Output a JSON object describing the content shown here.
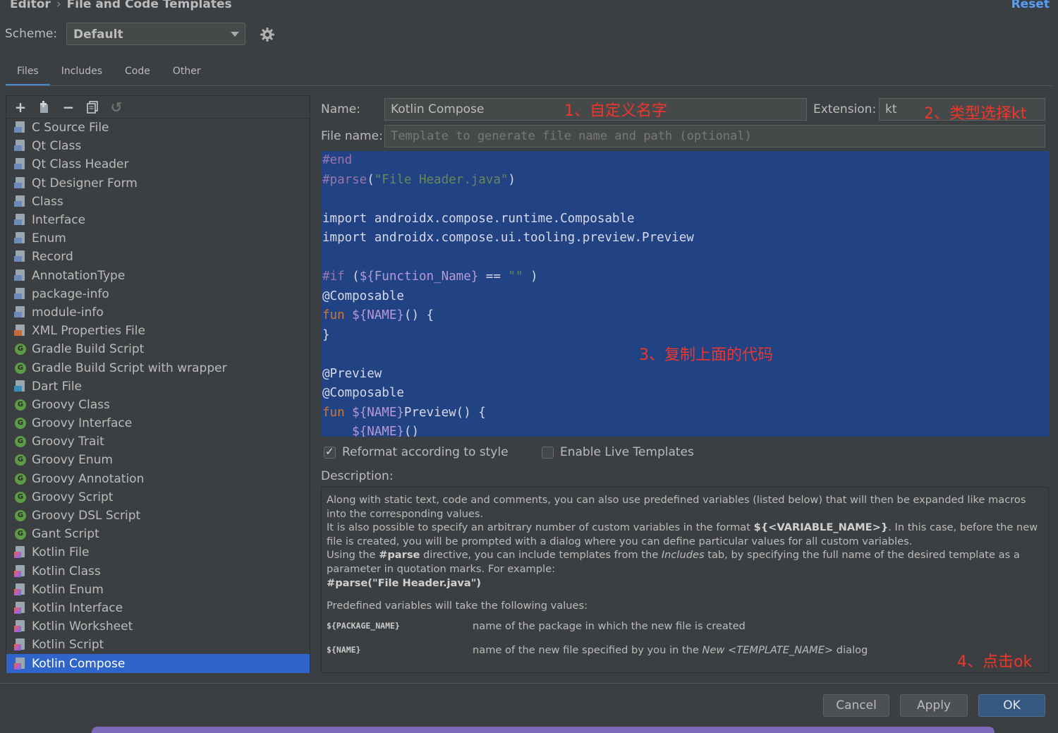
{
  "breadcrumb": {
    "parent": "Editor",
    "separator": "›",
    "current": "File and Code Templates"
  },
  "reset_label": "Reset",
  "scheme": {
    "label": "Scheme:",
    "value": "Default"
  },
  "tabs": [
    {
      "label": "Files",
      "active": true
    },
    {
      "label": "Includes"
    },
    {
      "label": "Code"
    },
    {
      "label": "Other"
    }
  ],
  "toolbar": {
    "add": "+",
    "remove": "−",
    "copy": "⧉",
    "reset": "↺"
  },
  "templates": [
    {
      "label": "C Source File",
      "icon": "doc"
    },
    {
      "label": "Qt Class",
      "icon": "doc"
    },
    {
      "label": "Qt Class Header",
      "icon": "doc"
    },
    {
      "label": "Qt Designer Form",
      "icon": "doc"
    },
    {
      "label": "Class",
      "icon": "doc"
    },
    {
      "label": "Interface",
      "icon": "doc"
    },
    {
      "label": "Enum",
      "icon": "doc"
    },
    {
      "label": "Record",
      "icon": "doc"
    },
    {
      "label": "AnnotationType",
      "icon": "doc"
    },
    {
      "label": "package-info",
      "icon": "doc"
    },
    {
      "label": "module-info",
      "icon": "doc"
    },
    {
      "label": "XML Properties File",
      "icon": "xml"
    },
    {
      "label": "Gradle Build Script",
      "icon": "gradle"
    },
    {
      "label": "Gradle Build Script with wrapper",
      "icon": "gradle"
    },
    {
      "label": "Dart File",
      "icon": "dart"
    },
    {
      "label": "Groovy Class",
      "icon": "gradle"
    },
    {
      "label": "Groovy Interface",
      "icon": "gradle"
    },
    {
      "label": "Groovy Trait",
      "icon": "gradle"
    },
    {
      "label": "Groovy Enum",
      "icon": "gradle"
    },
    {
      "label": "Groovy Annotation",
      "icon": "gradle"
    },
    {
      "label": "Groovy Script",
      "icon": "gradle"
    },
    {
      "label": "Groovy DSL Script",
      "icon": "gradle"
    },
    {
      "label": "Gant Script",
      "icon": "gradle"
    },
    {
      "label": "Kotlin File",
      "icon": "kotlin"
    },
    {
      "label": "Kotlin Class",
      "icon": "kotlin"
    },
    {
      "label": "Kotlin Enum",
      "icon": "kotlin"
    },
    {
      "label": "Kotlin Interface",
      "icon": "kotlin"
    },
    {
      "label": "Kotlin Worksheet",
      "icon": "kotlin"
    },
    {
      "label": "Kotlin Script",
      "icon": "kotlin"
    },
    {
      "label": "Kotlin Compose",
      "icon": "kotlin",
      "selected": true
    }
  ],
  "form": {
    "name_label": "Name:",
    "name_value": "Kotlin Compose",
    "extension_label": "Extension:",
    "extension_value": "kt",
    "filename_label": "File name:",
    "filename_placeholder": "Template to generate file name and path (optional)"
  },
  "annotations": {
    "a1": "1、自定义名字",
    "a2": "2、类型选择kt",
    "a3": "3、复制上面的代码",
    "a4": "4、点击ok"
  },
  "code_lines": [
    [
      {
        "t": "#end",
        "c": "dir"
      }
    ],
    [
      {
        "t": "#parse",
        "c": "dir"
      },
      {
        "t": "(",
        "c": "plain"
      },
      {
        "t": "\"File Header.java\"",
        "c": "str"
      },
      {
        "t": ")",
        "c": "plain"
      }
    ],
    [],
    [
      {
        "t": "import androidx.compose.runtime.Composable",
        "c": "plain"
      }
    ],
    [
      {
        "t": "import androidx.compose.ui.tooling.preview.Preview",
        "c": "plain"
      }
    ],
    [],
    [
      {
        "t": "#if",
        "c": "dir"
      },
      {
        "t": " (",
        "c": "plain"
      },
      {
        "t": "${Function_Name}",
        "c": "var"
      },
      {
        "t": " == ",
        "c": "plain"
      },
      {
        "t": "\"\"",
        "c": "str"
      },
      {
        "t": " )",
        "c": "plain"
      }
    ],
    [
      {
        "t": "@Composable",
        "c": "plain"
      }
    ],
    [
      {
        "t": "fun",
        "c": "kw"
      },
      {
        "t": " ",
        "c": "plain"
      },
      {
        "t": "${NAME}",
        "c": "var"
      },
      {
        "t": "() {",
        "c": "plain"
      }
    ],
    [
      {
        "t": "}",
        "c": "plain"
      }
    ],
    [],
    [
      {
        "t": "@Preview",
        "c": "plain"
      }
    ],
    [
      {
        "t": "@Composable",
        "c": "plain"
      }
    ],
    [
      {
        "t": "fun",
        "c": "kw"
      },
      {
        "t": " ",
        "c": "plain"
      },
      {
        "t": "${NAME}",
        "c": "var"
      },
      {
        "t": "Preview() {",
        "c": "plain"
      }
    ],
    [
      {
        "t": "    ",
        "c": "plain"
      },
      {
        "t": "${NAME}",
        "c": "var"
      },
      {
        "t": "()",
        "c": "plain"
      }
    ]
  ],
  "options": {
    "reformat_label": "Reformat according to style",
    "reformat_checked": true,
    "live_templates_label": "Enable Live Templates",
    "live_templates_checked": false
  },
  "description": {
    "label": "Description:",
    "p1": "Along with static text, code and comments, you can also use predefined variables (listed below) that will then be expanded like macros into the corresponding values.",
    "p2_a": "It is also possible to specify an arbitrary number of custom variables in the format ",
    "p2_b": "${<VARIABLE_NAME>}",
    "p2_c": ". In this case, before the new file is created, you will be prompted with a dialog where you can define particular values for all custom variables.",
    "p3_a": "Using the ",
    "p3_b": "#parse",
    "p3_c": " directive, you can include templates from the ",
    "p3_d": "Includes",
    "p3_e": " tab, by specifying the full name of the desired template as a parameter in quotation marks. For example:",
    "p4": "#parse(\"File Header.java\")",
    "p5": "Predefined variables will take the following values:",
    "vars": [
      {
        "name": "${PACKAGE_NAME}",
        "desc_a": "name of the package in which the new file is created",
        "desc_b": "",
        "desc_c": ""
      },
      {
        "name": "${NAME}",
        "desc_a": "name of the new file specified by you in the ",
        "desc_b": "New <TEMPLATE_NAME>",
        "desc_c": " dialog"
      }
    ]
  },
  "buttons": {
    "cancel": "Cancel",
    "apply": "Apply",
    "ok": "OK"
  }
}
